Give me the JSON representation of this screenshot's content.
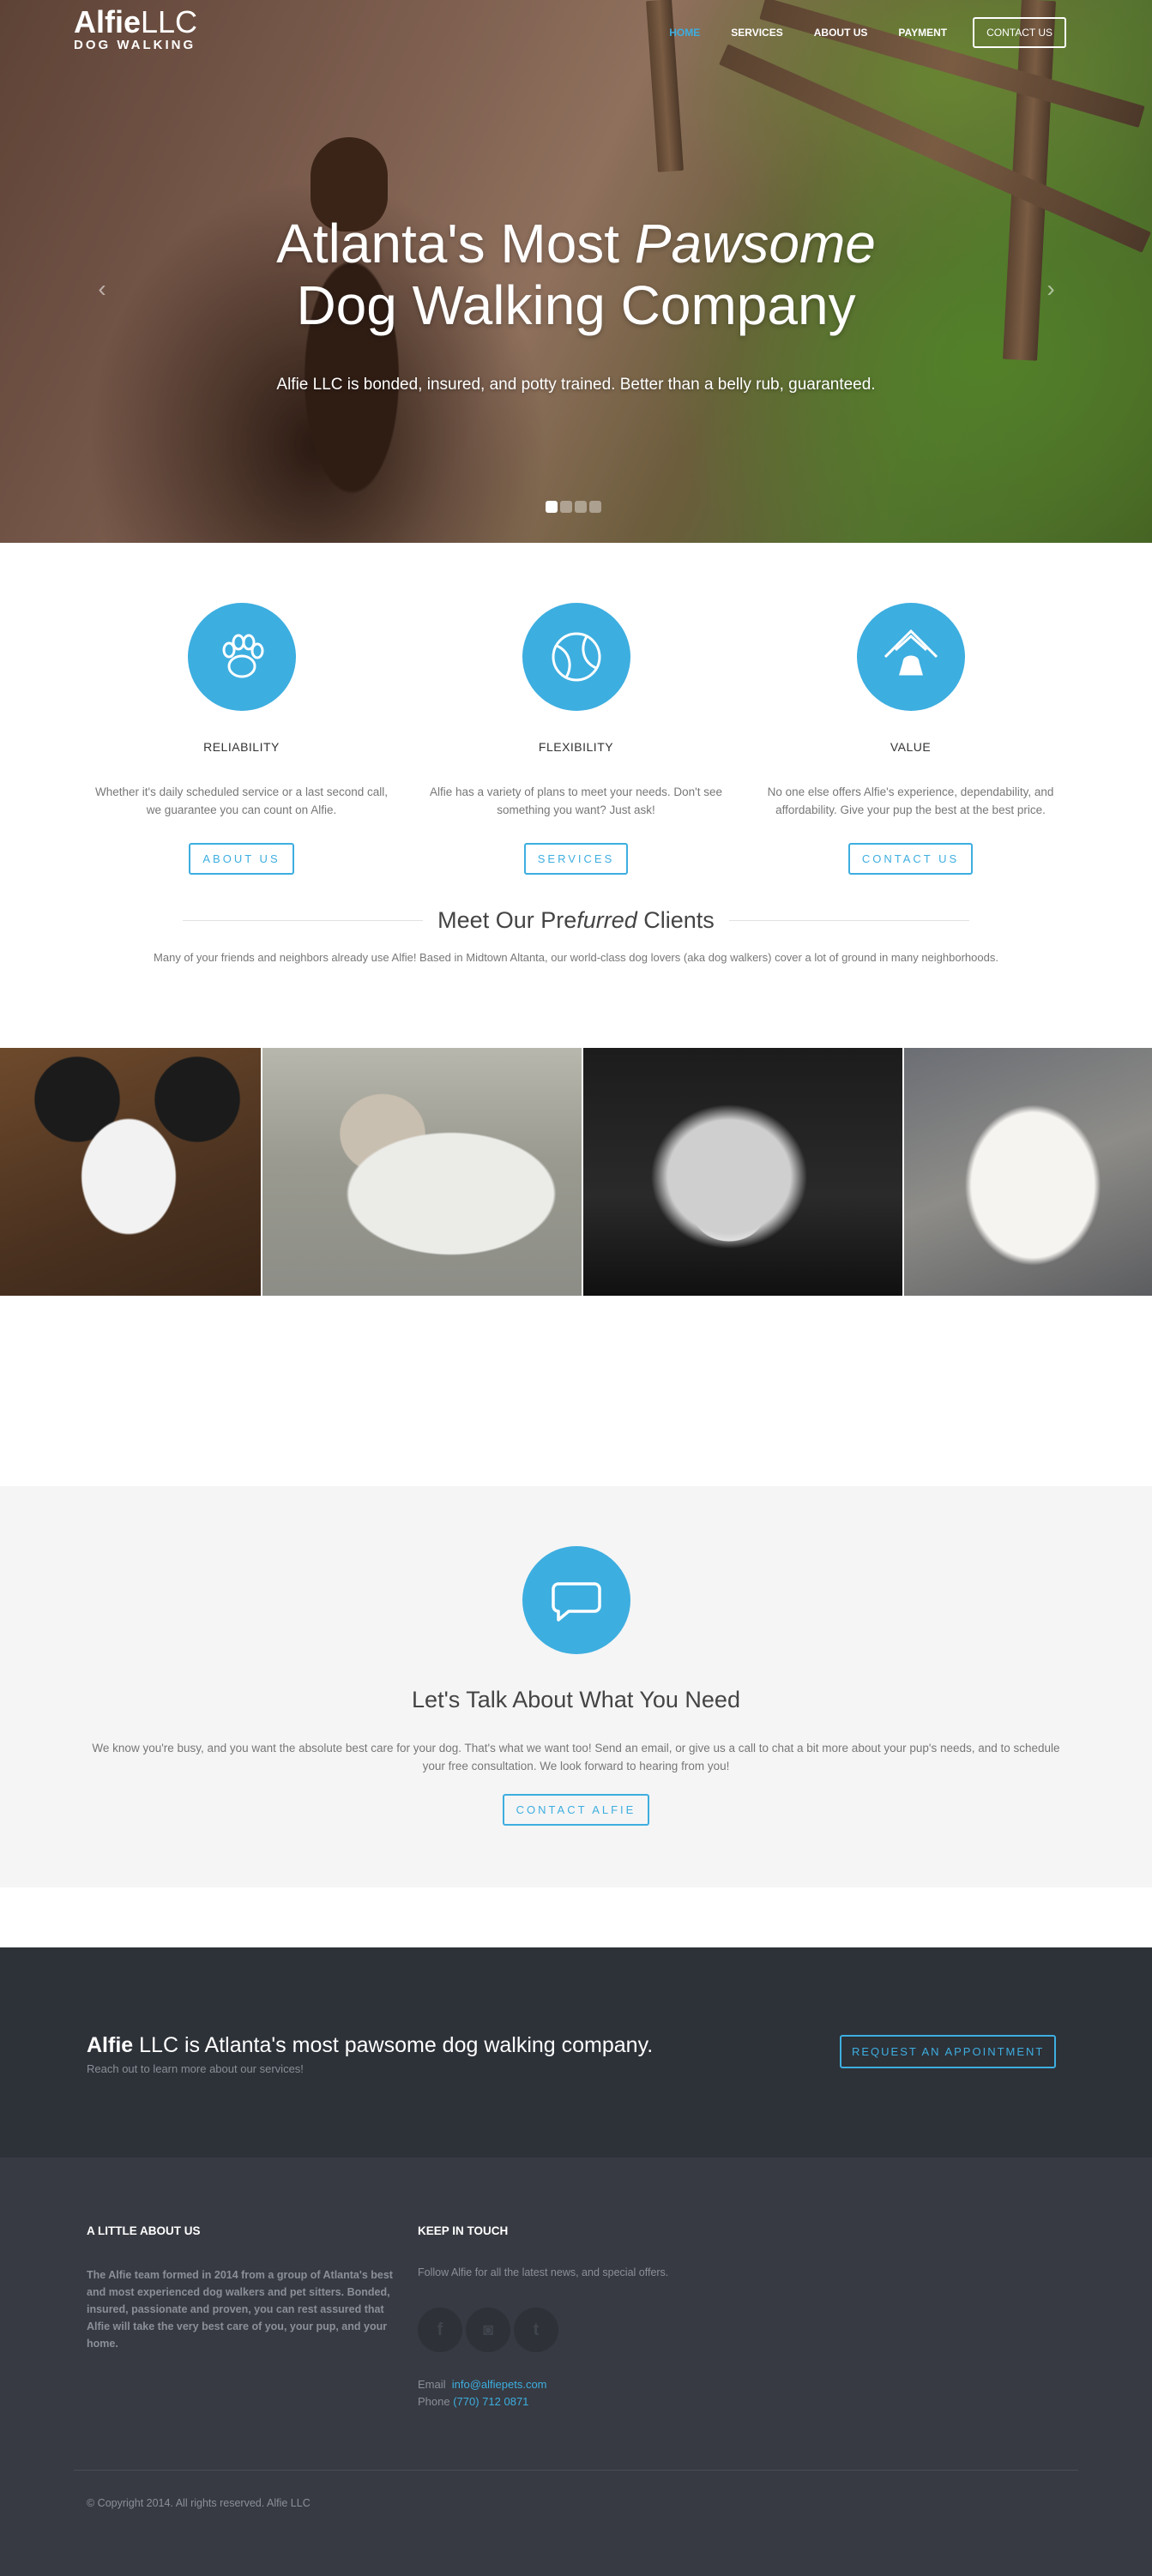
{
  "nav": {
    "logo_bold": "Alfie",
    "logo_light": "LLC",
    "logo_sub": "DOG WALKING",
    "items": [
      {
        "label": "HOME"
      },
      {
        "label": "SERVICES"
      },
      {
        "label": "ABOUT US"
      },
      {
        "label": "PAYMENT"
      },
      {
        "label": "CONTACT US"
      }
    ]
  },
  "hero": {
    "title_line1_plain": "Atlanta's Most ",
    "title_line1_italic": "Pawsome",
    "title_line2": "Dog Walking Company",
    "subtitle": "Alfie LLC is bonded, insured, and potty trained. Better than a belly rub, guaranteed.",
    "slide_count": 4,
    "active_slide": 1
  },
  "features": [
    {
      "icon": "paw-icon",
      "title": "RELIABILITY",
      "text": "Whether it's daily scheduled service or a last second call, we guarantee you can count on Alfie.",
      "button": "ABOUT US"
    },
    {
      "icon": "ball-icon",
      "title": "FLEXIBILITY",
      "text": "Alfie has a variety of plans to meet your needs. Don't see something you want? Just ask!",
      "button": "SERVICES"
    },
    {
      "icon": "doghouse-icon",
      "title": "VALUE",
      "text": "No one else offers Alfie's experience, dependability, and affordability. Give your pup the best at the best price.",
      "button": "CONTACT US"
    }
  ],
  "clients": {
    "title_a": "Meet Our Pre",
    "title_italic": "furred",
    "title_b": " Clients",
    "description": "Many of your friends and neighbors already use Alfie! Based in Midtown Altanta, our world-class dog lovers (aka dog walkers) cover a lot of ground in many neighborhoods.",
    "photos": [
      "border-collie-photo",
      "pug-photo",
      "australian-shepherd-photo",
      "havanese-photo"
    ]
  },
  "talk": {
    "icon": "speech-bubble-icon",
    "title": "Let's Talk About What You Need",
    "text": "We know you're busy, and you want the absolute best care for your dog. That's what we want too! Send an email, or give us a call to chat a bit more about your pup's needs, and to schedule your free consultation. We look forward to hearing from you!",
    "button": "CONTACT ALFIE"
  },
  "band": {
    "title_bold": "Alfie",
    "title_rest": " LLC is Atlanta's most pawsome dog walking company.",
    "subtitle": "Reach out to learn more about our services!",
    "button": "REQUEST AN APPOINTMENT"
  },
  "footer": {
    "about_heading": "A LITTLE ABOUT US",
    "about_text": "The Alfie team formed in 2014 from a group of Atlanta's best and most experienced dog walkers and pet sitters. Bonded, insured, passionate and proven, you can rest assured that Alfie will take the very best care of you, your pup, and your home.",
    "touch_heading": "KEEP IN TOUCH",
    "touch_text": "Follow Alfie for all the latest news, and special offers.",
    "socials": [
      {
        "icon": "facebook-icon",
        "glyph": "f"
      },
      {
        "icon": "instagram-icon",
        "glyph": "◙"
      },
      {
        "icon": "twitter-icon",
        "glyph": "t"
      }
    ],
    "email_label": "Email",
    "email_value": "info@alfiepets.com",
    "phone_label": "Phone",
    "phone_value": "(770) 712 0871",
    "copyright": "© Copyright 2014. All rights reserved. Alfie LLC"
  },
  "colors": {
    "accent": "#3daee0",
    "band_bg": "#2d3138",
    "footer_bg": "#373a42",
    "talk_bg": "#f5f5f5"
  }
}
